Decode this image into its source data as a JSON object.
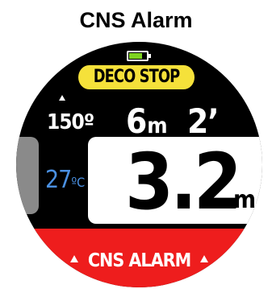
{
  "page": {
    "title": "CNS Alarm"
  },
  "status_bar": {
    "battery_icon": "battery-icon",
    "battery_level": 0.85,
    "battery_color": "#7ed321"
  },
  "deco": {
    "badge_label": "DECO STOP",
    "badge_color": "#f5e13a",
    "stop_depth_value": "6",
    "stop_depth_unit": "m",
    "stop_time": "2’"
  },
  "compass": {
    "arrow_icon": "up-arrow-icon",
    "heading": "150º"
  },
  "temperature": {
    "value": "27",
    "unit": "ºC",
    "color": "#4a90e2"
  },
  "depth": {
    "value": "3.2",
    "unit": "m"
  },
  "alarm": {
    "label": "CNS ALARM",
    "arrow_icon": "up-arrow-icon",
    "color": "#ee1d1d"
  }
}
